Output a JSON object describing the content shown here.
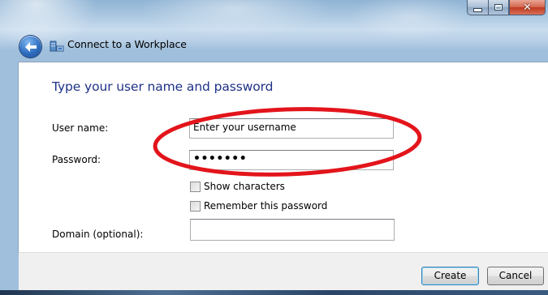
{
  "window": {
    "title": "Connect to a Workplace",
    "caption_buttons": {
      "minimize": "minimize",
      "maximize": "maximize",
      "close": "close"
    }
  },
  "page": {
    "heading": "Type your user name and password",
    "username": {
      "label": "User name:",
      "value": "Enter your username"
    },
    "password": {
      "label": "Password:",
      "value": "•••••••"
    },
    "show_characters": {
      "label": "Show characters",
      "checked": false
    },
    "remember_password": {
      "label": "Remember this password",
      "checked": false
    },
    "domain": {
      "label": "Domain (optional):",
      "value": ""
    }
  },
  "footer": {
    "create_label": "Create",
    "cancel_label": "Cancel"
  },
  "annotation": {
    "color": "#e3141b",
    "shape": "ellipse"
  },
  "icons": [
    "back-arrow-icon",
    "workplace-connection-icon",
    "minimize-icon",
    "maximize-icon",
    "close-icon"
  ]
}
